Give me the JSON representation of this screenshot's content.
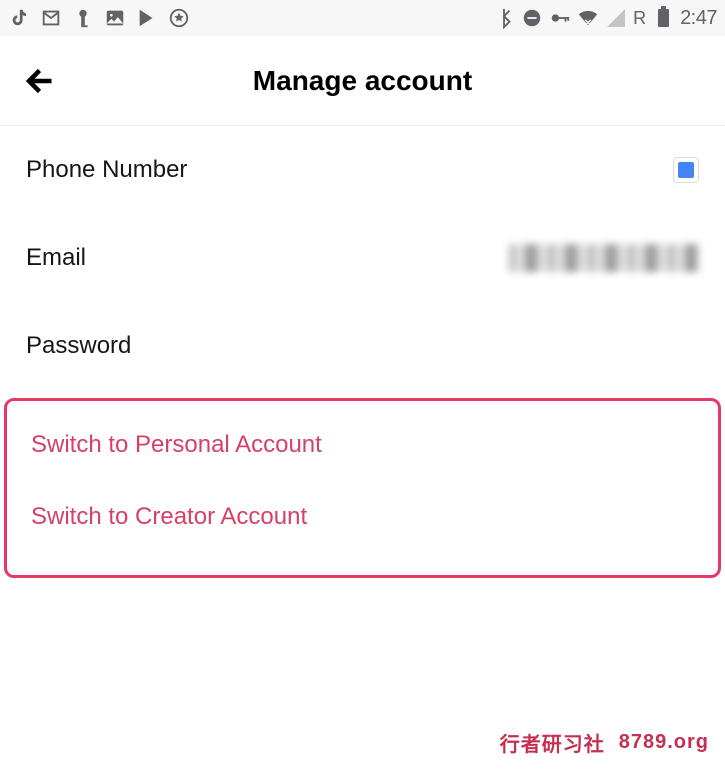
{
  "status": {
    "time": "2:47",
    "roaming": "R"
  },
  "header": {
    "title": "Manage account"
  },
  "rows": {
    "phone_label": "Phone Number",
    "email_label": "Email",
    "password_label": "Password"
  },
  "switch": {
    "personal": "Switch to Personal Account",
    "creator": "Switch to Creator Account"
  },
  "watermark": {
    "cn": "行者研习社",
    "domain": "8789.org"
  }
}
